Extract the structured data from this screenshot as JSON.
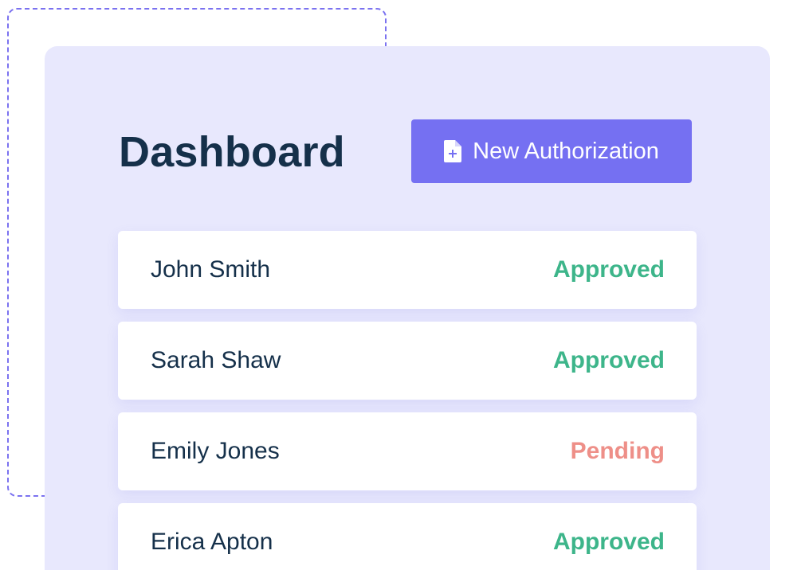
{
  "dashboard": {
    "title": "Dashboard",
    "new_button": {
      "label": "New Authorization",
      "icon": "file-plus-icon"
    }
  },
  "authorizations": [
    {
      "name": "John Smith",
      "status": "Approved"
    },
    {
      "name": "Sarah Shaw",
      "status": "Approved"
    },
    {
      "name": "Emily Jones",
      "status": "Pending"
    },
    {
      "name": "Erica Apton",
      "status": "Approved"
    }
  ],
  "colors": {
    "accent": "#7570f2",
    "panel_background": "#e8e8fd",
    "title_text": "#15304a",
    "approved": "#3db58a",
    "pending": "#ee8f88"
  }
}
